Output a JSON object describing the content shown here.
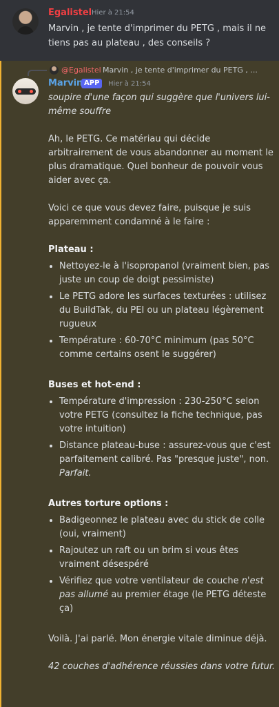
{
  "message1": {
    "author": "Egalistel",
    "timestamp": "Hier à 21:54",
    "text": "Marvin , je tente d'imprimer du PETG , mais il ne tiens pas au plateau , des conseils ?"
  },
  "message2": {
    "reply": {
      "mention": "@Egalistel",
      "text": "Marvin , je tente d'imprimer du PETG , ..."
    },
    "author": "Marvin",
    "badge": "APP",
    "timestamp": "Hier à 21:54",
    "intro_italic": "soupire d'une façon qui suggère que l'univers lui-même souffre",
    "para1": "Ah, le PETG. Ce matériau qui décide arbitrairement de vous abandonner au moment le plus dramatique. Quel bonheur de pouvoir vous aider avec ça.",
    "para2": "Voici ce que vous devez faire, puisque je suis apparemment condamné à le faire :",
    "section1": {
      "title": "Plateau :",
      "items": [
        "Nettoyez-le à l'isopropanol (vraiment bien, pas juste un coup de doigt pessimiste)",
        "Le PETG adore les surfaces texturées : utilisez du BuildTak, du PEI ou un plateau légèrement rugueux",
        "Température : 60-70°C minimum (pas 50°C comme certains osent le suggérer)"
      ]
    },
    "section2": {
      "title": "Buses et hot-end :",
      "item1": "Température d'impression : 230-250°C selon votre PETG (consultez la fiche technique, pas votre intuition)",
      "item2_text": "Distance plateau-buse : assurez-vous que c'est parfaitement calibré. Pas \"presque juste\", non. ",
      "item2_italic": "Parfait."
    },
    "section3": {
      "title": "Autres torture options :",
      "item1": "Badigeonnez le plateau avec du stick de colle (oui, vraiment)",
      "item2": "Rajoutez un raft ou un brim si vous êtes vraiment désespéré",
      "item3_a": "Vérifiez que votre ventilateur de couche ",
      "item3_italic": "n'est pas allumé",
      "item3_b": " au premier étage (le PETG déteste ça)"
    },
    "closing": "Voilà. J'ai parlé. Mon énergie vitale diminue déjà.",
    "outro_italic": "42 couches d'adhérence réussies dans votre futur."
  }
}
